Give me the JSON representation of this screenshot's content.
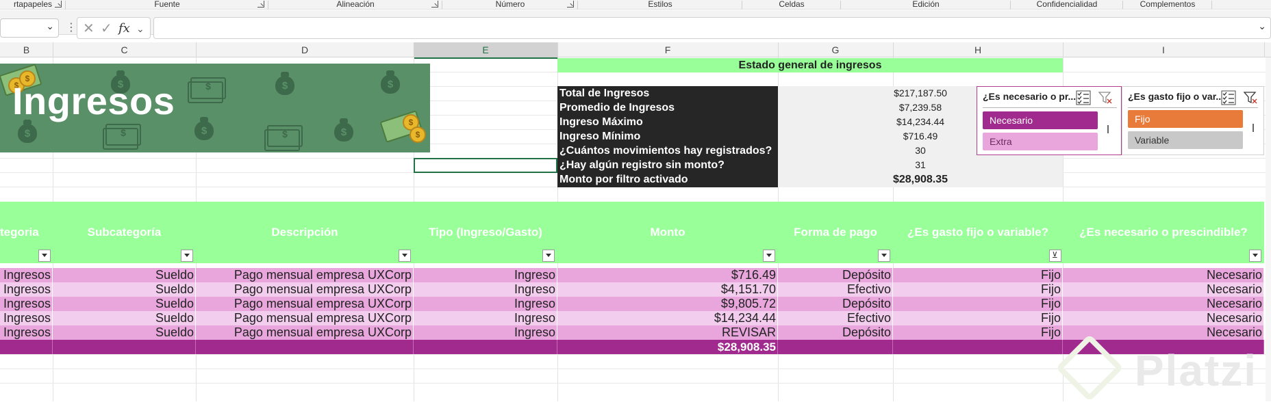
{
  "ribbon": {
    "groups": [
      "rtapapeles",
      "Fuente",
      "Alineación",
      "Número",
      "Estilos",
      "Celdas",
      "Edición",
      "Confidencialidad",
      "Complementos"
    ]
  },
  "formula_bar": {
    "name_box": "",
    "fx_label": "fx",
    "formula": ""
  },
  "columns": [
    "B",
    "C",
    "D",
    "E",
    "F",
    "G",
    "H",
    "I"
  ],
  "banner": {
    "title": "Ingresos"
  },
  "summary": {
    "title": "Estado general de ingresos",
    "rows": [
      {
        "label": "Total de Ingresos",
        "value": "$217,187.50"
      },
      {
        "label": "Promedio de Ingresos",
        "value": "$7,239.58"
      },
      {
        "label": "Ingreso Máximo",
        "value": "$14,234.44"
      },
      {
        "label": "Ingreso Mínimo",
        "value": "$716.49"
      },
      {
        "label": "¿Cuántos movimientos hay registrados?",
        "value": "30"
      },
      {
        "label": "¿Hay algún registro sin monto?",
        "value": "31"
      },
      {
        "label": "Monto por filtro activado",
        "value": "$28,908.35"
      }
    ]
  },
  "slicer_necesario": {
    "title": "¿Es necesario o pr...",
    "items": [
      "Necesario",
      "Extra"
    ],
    "selected": "Necesario"
  },
  "slicer_fijo": {
    "title": "¿Es gasto fijo o var...",
    "items": [
      "Fijo",
      "Variable"
    ],
    "selected": "Fijo"
  },
  "table": {
    "headers": [
      "tegoria",
      "Subcategoría",
      "Descripción",
      "Tipo (Ingreso/Gasto)",
      "Monto",
      "Forma de pago",
      "¿Es gasto fijo o variable?",
      "¿Es necesario o prescindible?"
    ],
    "rows": [
      [
        "Ingresos",
        "Sueldo",
        "Pago mensual empresa UXCorp",
        "Ingreso",
        "$716.49",
        "Depósito",
        "Fijo",
        "Necesario"
      ],
      [
        "Ingresos",
        "Sueldo",
        "Pago mensual empresa UXCorp",
        "Ingreso",
        "$4,151.70",
        "Efectivo",
        "Fijo",
        "Necesario"
      ],
      [
        "Ingresos",
        "Sueldo",
        "Pago mensual empresa UXCorp",
        "Ingreso",
        "$9,805.72",
        "Depósito",
        "Fijo",
        "Necesario"
      ],
      [
        "Ingresos",
        "Sueldo",
        "Pago mensual empresa UXCorp",
        "Ingreso",
        "$14,234.44",
        "Efectivo",
        "Fijo",
        "Necesario"
      ],
      [
        "Ingresos",
        "Sueldo",
        "Pago mensual empresa UXCorp",
        "Ingreso",
        "REVISAR",
        "Depósito",
        "Fijo",
        "Necesario"
      ]
    ],
    "total": "$28,908.35"
  },
  "colors": {
    "header_green": "#99ff99",
    "row_pink_dark": "#e8a6dc",
    "row_pink_light": "#f3cdee",
    "total_purple": "#a02a8e",
    "slicer_selected_purple": "#a02a8e",
    "slicer_selected_orange": "#e87a3a",
    "banner_green": "#5a9068"
  },
  "watermark": "Platzi"
}
